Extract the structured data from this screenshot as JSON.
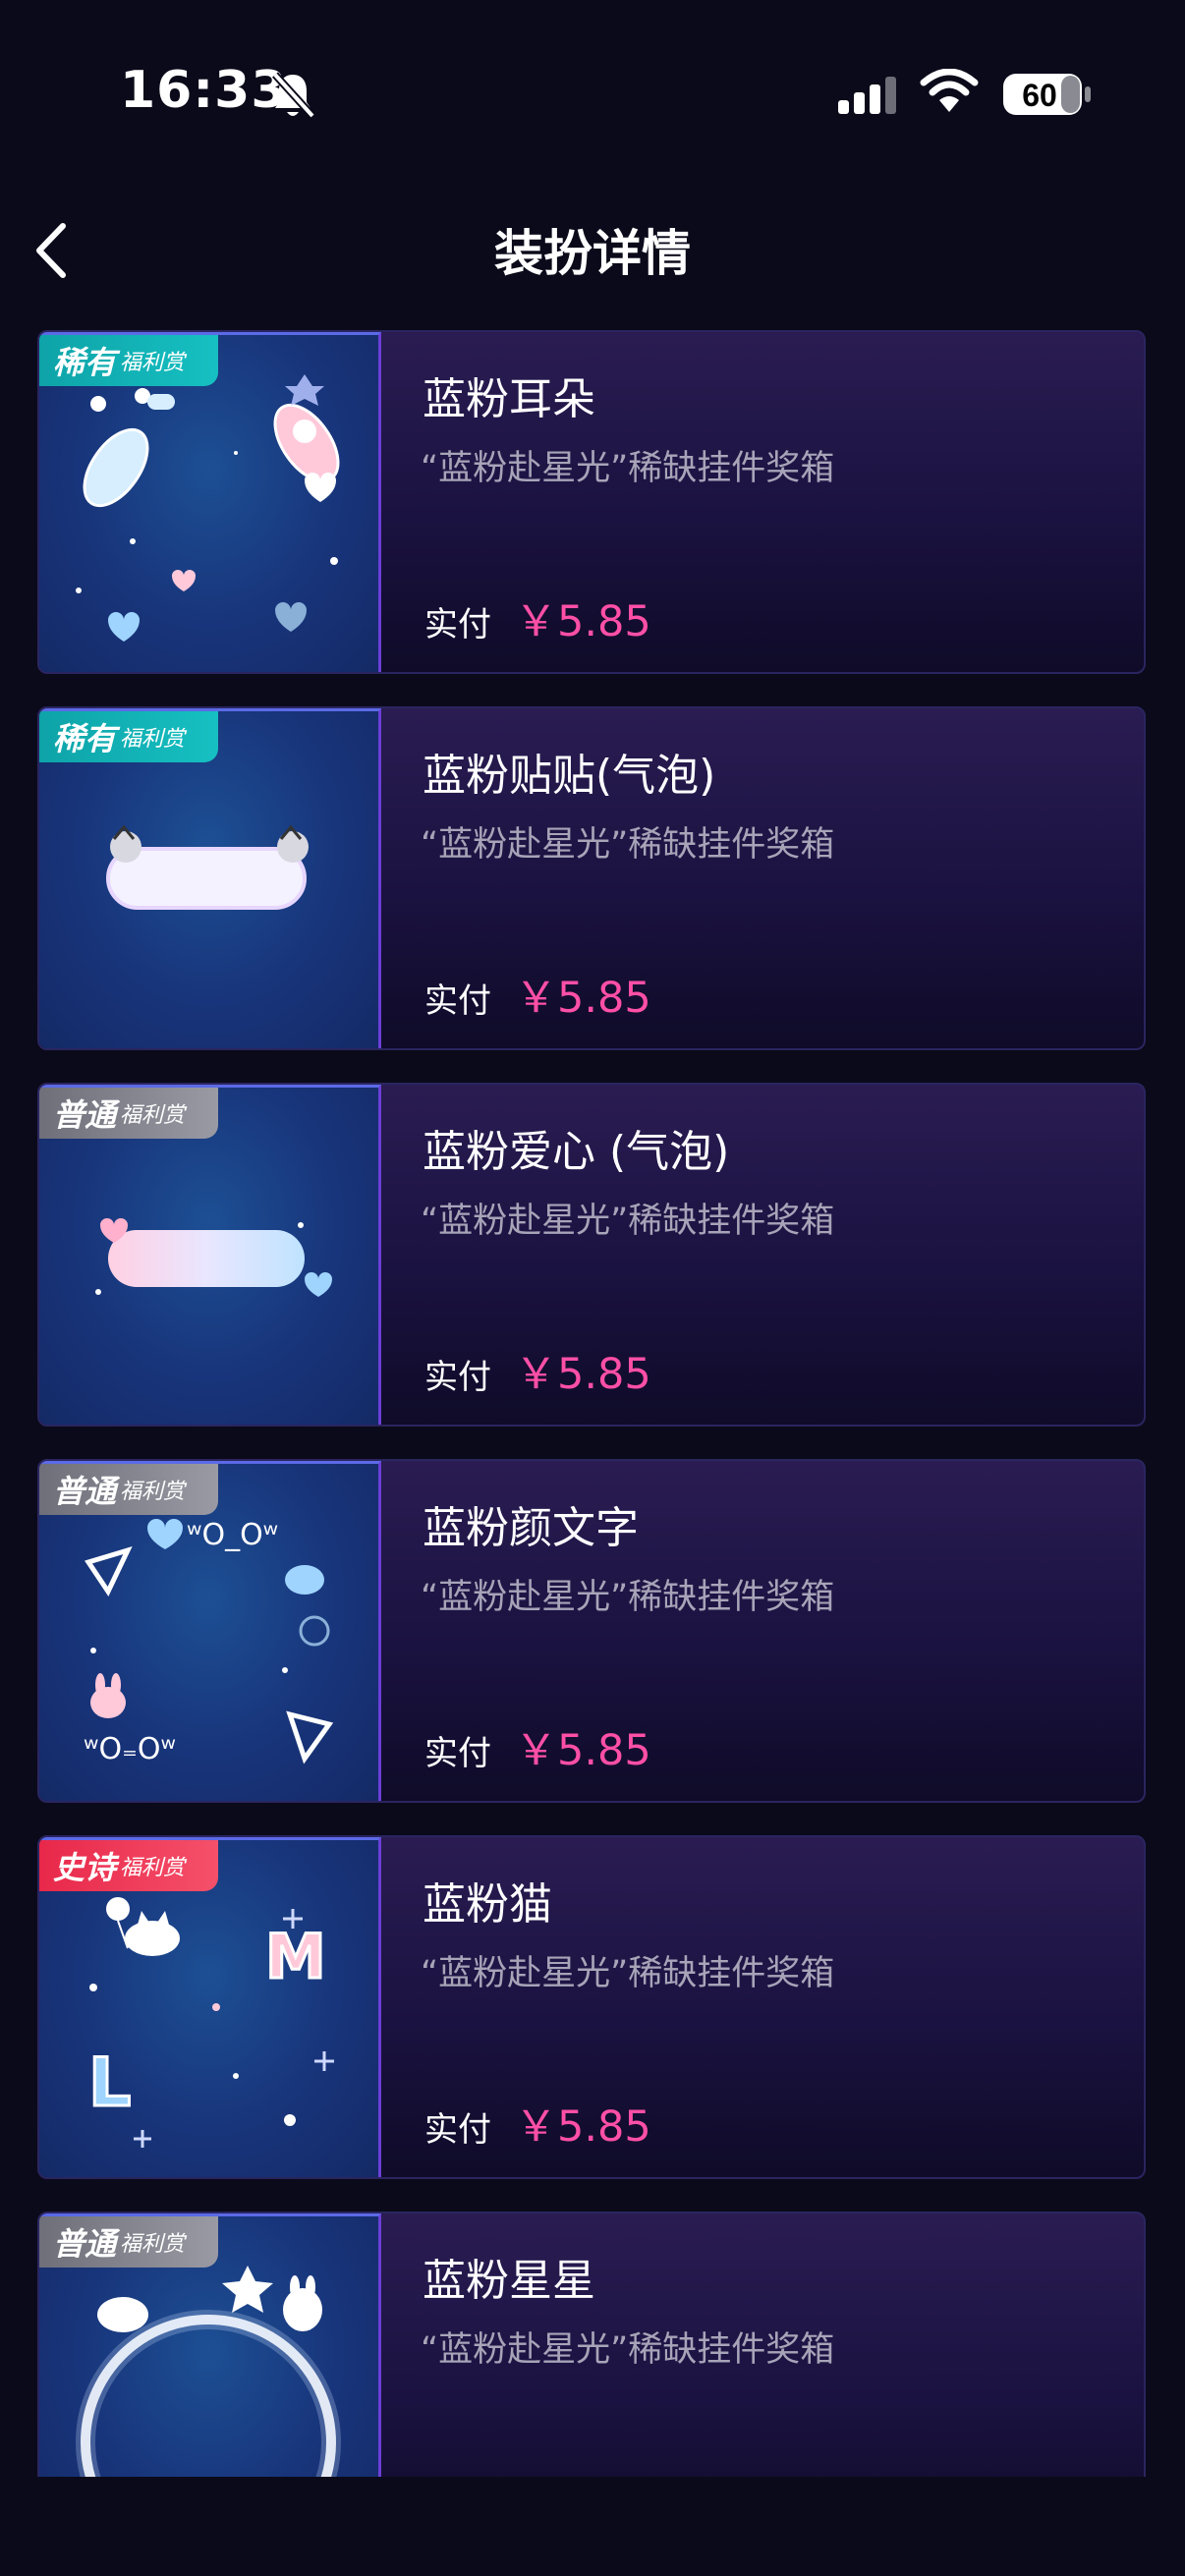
{
  "status_bar": {
    "time": "16:33",
    "battery": "60"
  },
  "header": {
    "title": "装扮详情"
  },
  "items": [
    {
      "badge_main": "稀有",
      "badge_sub": "福利赏",
      "badge_type": "rare",
      "name": "蓝粉耳朵",
      "subtitle": "“蓝粉赴星光”稀缺挂件奖箱",
      "price_label": "实付",
      "price": "￥5.85"
    },
    {
      "badge_main": "稀有",
      "badge_sub": "福利赏",
      "badge_type": "rare",
      "name": "蓝粉贴贴(气泡)",
      "subtitle": "“蓝粉赴星光”稀缺挂件奖箱",
      "price_label": "实付",
      "price": "￥5.85"
    },
    {
      "badge_main": "普通",
      "badge_sub": "福利赏",
      "badge_type": "normal",
      "name": "蓝粉爱心 (气泡)",
      "subtitle": "“蓝粉赴星光”稀缺挂件奖箱",
      "price_label": "实付",
      "price": "￥5.85"
    },
    {
      "badge_main": "普通",
      "badge_sub": "福利赏",
      "badge_type": "normal",
      "name": "蓝粉颜文字",
      "subtitle": "“蓝粉赴星光”稀缺挂件奖箱",
      "price_label": "实付",
      "price": "￥5.85"
    },
    {
      "badge_main": "史诗",
      "badge_sub": "福利赏",
      "badge_type": "epic",
      "name": "蓝粉猫",
      "subtitle": "“蓝粉赴星光”稀缺挂件奖箱",
      "price_label": "实付",
      "price": "￥5.85"
    },
    {
      "badge_main": "普通",
      "badge_sub": "福利赏",
      "badge_type": "normal",
      "name": "蓝粉星星",
      "subtitle": "“蓝粉赴星光”稀缺挂件奖箱",
      "price_label": "",
      "price": ""
    }
  ]
}
